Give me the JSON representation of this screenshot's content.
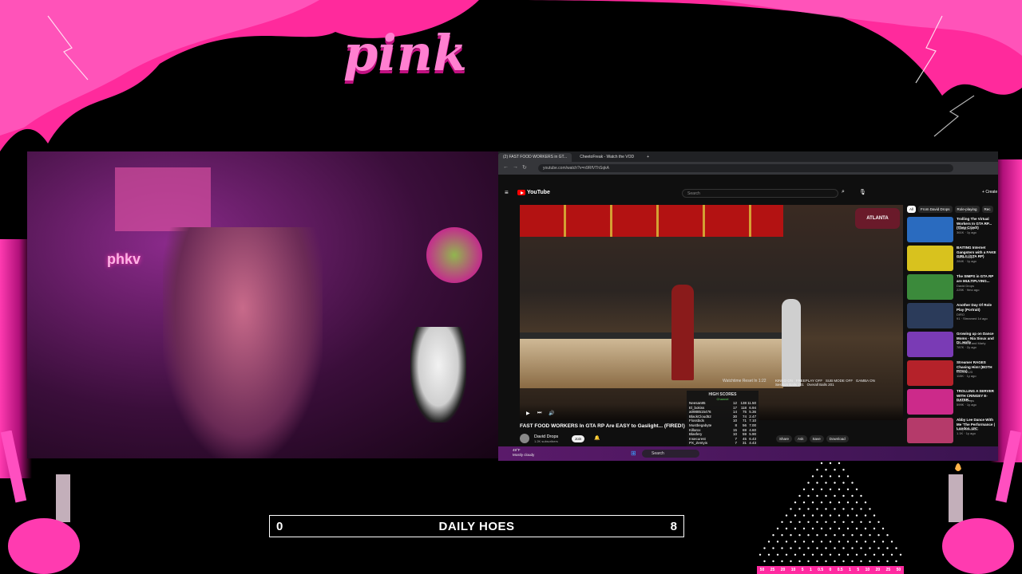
{
  "overlay": {
    "brand_word": "pink",
    "score_left": "0",
    "score_title": "DAILY HOES",
    "score_right": "8",
    "plinko_values": [
      "50",
      "25",
      "20",
      "10",
      "5",
      "1",
      "0.5",
      "0",
      "0.5",
      "1",
      "5",
      "10",
      "20",
      "25",
      "50"
    ]
  },
  "webcam": {
    "neon_sign": "phkv"
  },
  "browser": {
    "tabs": [
      {
        "label": "(2) FAST FOOD WORKERS in GT..."
      },
      {
        "label": "CheetoFreak - Watch the VOD"
      }
    ],
    "url": "youtube.com/watch?v=n9RfVThSqkA"
  },
  "youtube": {
    "logo": "YouTube",
    "search_placeholder": "Search",
    "create_label": "Create",
    "video_title": "FAST FOOD WORKERS In GTA RP Are EASY to Gaslight... (FIRED!)",
    "channel_name": "David Drops",
    "subscribers": "1.2K subscribers",
    "join_label": "Join",
    "actions": [
      "Share",
      "Ask",
      "Save",
      "Download"
    ],
    "chips": [
      "All",
      "From David Drops",
      "Role-playing",
      "Rec"
    ],
    "recommendations": [
      {
        "title": "Trolling The Virtual Workers In GTA RP... (They Cried!)",
        "channel": "David Drops",
        "meta": "361K · 1y ago",
        "color": "#2a6bbf"
      },
      {
        "title": "BAITING Internet Gangsters with a FAKE GIRL!! (GTA RP)",
        "channel": "David Drops",
        "meta": "284K · 1y ago",
        "color": "#d8c21e"
      },
      {
        "title": "The SIMPS in GTA RP are MULTIPLYING...",
        "channel": "David Drops",
        "meta": "225K · 9mo ago",
        "color": "#3b8a3b"
      },
      {
        "title": "Another Day Of Role Play (Portrait)",
        "channel": "DIRO",
        "meta": "91 · Streamed 1d ago",
        "color": "#2b3b5a"
      },
      {
        "title": "Growing up on Dance Moms - Nia Sioux and Dr. Holly",
        "channel": "Motorlabs and Marty",
        "meta": "787K · 2y ago",
        "color": "#7a3bb5"
      },
      {
        "title": "Streamer RAGES Chasing Him! (BOTH POVs)",
        "channel": "JoJitice123",
        "meta": "115K · 1y ago",
        "color": "#b5222a"
      },
      {
        "title": "TROLLING A SERVER WITH CRINGEY E-DATER...",
        "channel": "David Drops",
        "meta": "599K · 1y ago",
        "color": "#cc2a8a"
      },
      {
        "title": "Abby Lee Dance With Me 'The Performance | London, UK'",
        "channel": "Abby Lee Miller",
        "meta": "1.1K · 1y ago",
        "color": "#b53a6a"
      }
    ]
  },
  "game_hud": {
    "watchtime": "Watchtime Reset In 1:22",
    "kinko": "KINKO ON",
    "freeplay": "FREEPLAY OFF",
    "sub_mode": "SUB MODE OFF",
    "gamba": "GAMBA ON",
    "session_balls_label": "Session Balls",
    "session_balls": "201",
    "overall_balls_label": "Overall Balls",
    "overall_balls": "201",
    "high_scores_title": "HIGH SCORES",
    "high_scores_sub": "Channel",
    "high_scores": [
      {
        "name": "Neesan85",
        "a": "12",
        "b": "138",
        "c": "11.50"
      },
      {
        "name": "El_bokiss",
        "a": "17",
        "b": "118",
        "c": "6.94"
      },
      {
        "name": "a0988515476",
        "a": "14",
        "b": "75",
        "c": "5.36"
      },
      {
        "name": "BlackCloud52",
        "a": "30",
        "b": "74",
        "c": "2.47"
      },
      {
        "name": "Flossbids",
        "a": "10",
        "b": "71",
        "c": "7.10"
      },
      {
        "name": "Mustbegabyte",
        "a": "8",
        "b": "56",
        "c": "7.00"
      },
      {
        "name": "Killarxx",
        "a": "15",
        "b": "69",
        "c": "4.60"
      },
      {
        "name": "Blasfery",
        "a": "10",
        "b": "59",
        "c": "5.90"
      },
      {
        "name": "Insecurest",
        "a": "7",
        "b": "45",
        "c": "6.43"
      },
      {
        "name": "PX_Zentyis",
        "a": "7",
        "b": "31",
        "c": "4.43"
      }
    ]
  },
  "taskbar": {
    "weather_temp": "49°F",
    "weather_desc": "Mostly cloudy",
    "search_label": "Search"
  }
}
